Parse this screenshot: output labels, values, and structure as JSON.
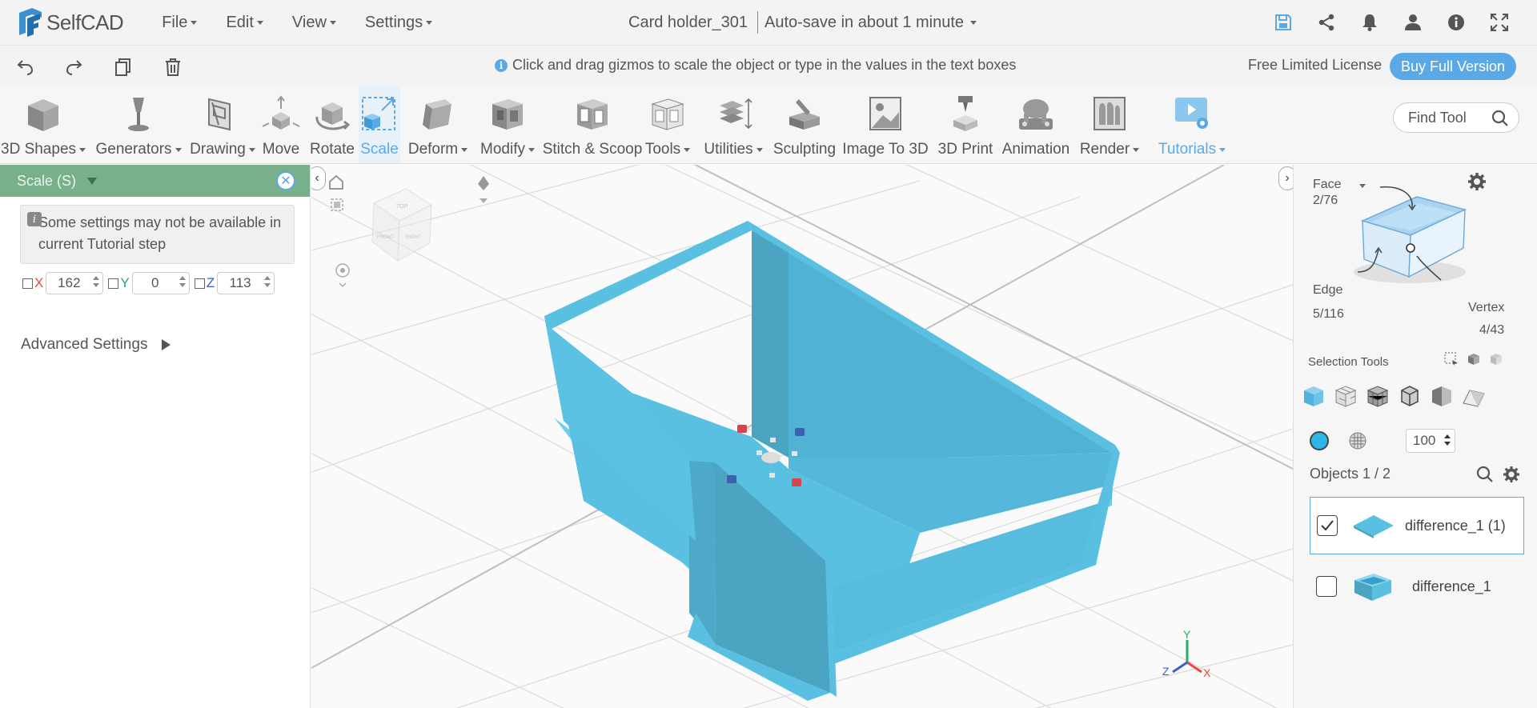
{
  "app": {
    "name": "SelfCAD",
    "menus": [
      "File",
      "Edit",
      "View",
      "Settings"
    ],
    "document_title": "Card holder_301",
    "autosave": "Auto-save in about 1 minute"
  },
  "top_icons": [
    "save-icon",
    "share-icon",
    "bell-icon",
    "user-icon",
    "info-icon",
    "fullscreen-icon"
  ],
  "actionbar": {
    "hint": "Click and drag gizmos to scale the object or type in the values in the text boxes",
    "license": "Free Limited License",
    "buy_label": "Buy Full Version"
  },
  "toolbar": {
    "tools": [
      {
        "label": "3D Shapes",
        "dropdown": true
      },
      {
        "label": "Generators",
        "dropdown": true
      },
      {
        "label": "Drawing",
        "dropdown": true
      },
      {
        "label": "Move",
        "dropdown": false
      },
      {
        "label": "Rotate",
        "dropdown": false
      },
      {
        "label": "Scale",
        "dropdown": false
      },
      {
        "label": "Deform",
        "dropdown": true
      },
      {
        "label": "Modify",
        "dropdown": true
      },
      {
        "label": "Stitch & Scoop",
        "dropdown": false
      },
      {
        "label": "Tools",
        "dropdown": true
      },
      {
        "label": "Utilities",
        "dropdown": true
      },
      {
        "label": "Sculpting",
        "dropdown": false
      },
      {
        "label": "Image To 3D",
        "dropdown": false
      },
      {
        "label": "3D Print",
        "dropdown": false
      },
      {
        "label": "Animation",
        "dropdown": false
      },
      {
        "label": "Render",
        "dropdown": true
      },
      {
        "label": "Tutorials",
        "dropdown": true
      }
    ],
    "find_placeholder": "Find Tool"
  },
  "left_panel": {
    "title": "Scale (S)",
    "tutorial_note": "Some settings may not be available in current Tutorial step",
    "x_label": "X",
    "x_value": "162",
    "y_label": "Y",
    "y_value": "0",
    "z_label": "Z",
    "z_value": "113",
    "advanced": "Advanced Settings"
  },
  "viewport": {
    "cube_faces": [
      "TOP",
      "FRONT",
      "RIGHT"
    ],
    "axis_labels": [
      "Y",
      "Z",
      "X"
    ],
    "colors": {
      "object": "#5ac0e2",
      "object_dark": "#4aa4c2",
      "x_axis": "#e74c3c",
      "y_axis": "#27ae60",
      "z_axis": "#3a5fcd"
    }
  },
  "right_panel": {
    "face_label": "Face",
    "face_count": "2/76",
    "edge_label": "Edge",
    "edge_count": "5/116",
    "vertex_label": "Vertex",
    "vertex_count": "4/43",
    "selection_tools": "Selection Tools",
    "opacity": "100",
    "objects_title": "Objects 1 / 2",
    "objects": [
      {
        "name": "difference_1 (1)",
        "checked": true
      },
      {
        "name": "difference_1",
        "checked": false
      }
    ]
  }
}
